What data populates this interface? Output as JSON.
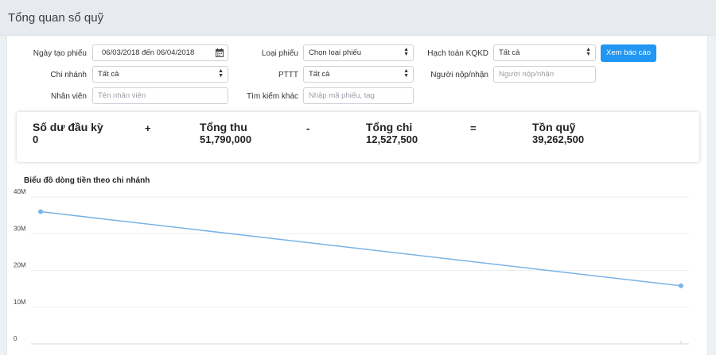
{
  "page": {
    "title": "Tổng quan sổ quỹ"
  },
  "filters": {
    "created_date": {
      "label": "Ngày tạo phiếu",
      "value": "06/03/2018 đến 06/04/2018"
    },
    "voucher_type": {
      "label": "Loại phiếu",
      "value": "Chọn loại phiếu"
    },
    "accounting": {
      "label": "Hạch toán KQKD",
      "value": "Tất cả"
    },
    "view_button": "Xem báo cáo",
    "branch": {
      "label": "Chi nhánh",
      "value": "Tất cả"
    },
    "payment_method": {
      "label": "PTTT",
      "value": "Tất cả"
    },
    "payer": {
      "label": "Người nộp/nhận",
      "placeholder": "Người nộp/nhận"
    },
    "employee": {
      "label": "Nhân viên",
      "placeholder": "Tên nhân viên"
    },
    "other_search": {
      "label": "Tìm kiếm khác",
      "placeholder": "Nhập mã phiếu, tag"
    }
  },
  "summary": {
    "opening": {
      "label": "Số dư đầu kỳ",
      "value": "0"
    },
    "op_plus": "+",
    "income": {
      "label": "Tổng thu",
      "value": "51,790,000"
    },
    "op_minus": "-",
    "expense": {
      "label": "Tổng chi",
      "value": "12,527,500"
    },
    "op_equals": "=",
    "balance": {
      "label": "Tồn quỹ",
      "value": "39,262,500"
    }
  },
  "chart_data": {
    "type": "line",
    "title": "Biểu đồ dòng tiền theo chi nhánh",
    "y_tick_labels": [
      "0",
      "10M",
      "20M",
      "30M",
      "40M"
    ],
    "ylim": [
      0,
      40000000
    ],
    "grid": true,
    "series": [
      {
        "color": "#7ab3e6",
        "values": [
          36000000,
          15800000
        ]
      }
    ]
  }
}
